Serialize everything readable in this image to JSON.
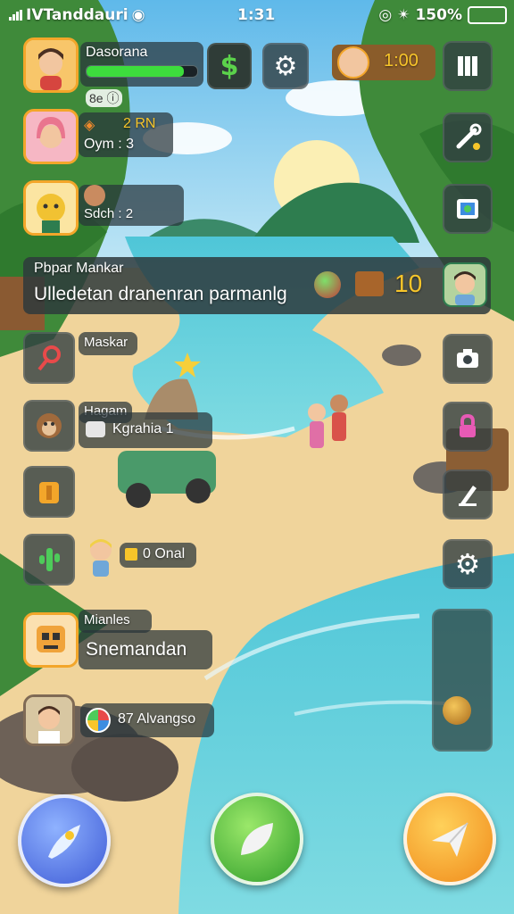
{
  "status_bar": {
    "carrier": "IVTanddauri",
    "time": "1:31",
    "battery": "150%"
  },
  "player": {
    "name": "Dasorana",
    "level": "8e",
    "currency_icon": "dollar-icon"
  },
  "coins": {
    "value": "1:00"
  },
  "friends": [
    {
      "line1": "2 RN",
      "line2": "Oym : 3"
    },
    {
      "line1": "Sdch : 2"
    }
  ],
  "quest_banner": {
    "title": "Pbpar Mankar",
    "description": "Ulledetan dranenran parmanlg",
    "reward_value": "10"
  },
  "npc_labels": {
    "maskar": "Maskar",
    "hagam": "Hagam",
    "hagam_sub": "Kgrahia 1",
    "loan": "0 Onal",
    "mianles": "Mianles",
    "snemandan": "Snemandan",
    "bottom_badge": "87 Alvangso"
  },
  "colors": {
    "panel": "#28343a",
    "accent_orange": "#f3a62a",
    "xp_green": "#3ddc3d",
    "quest_yellow": "#f7c52a"
  }
}
